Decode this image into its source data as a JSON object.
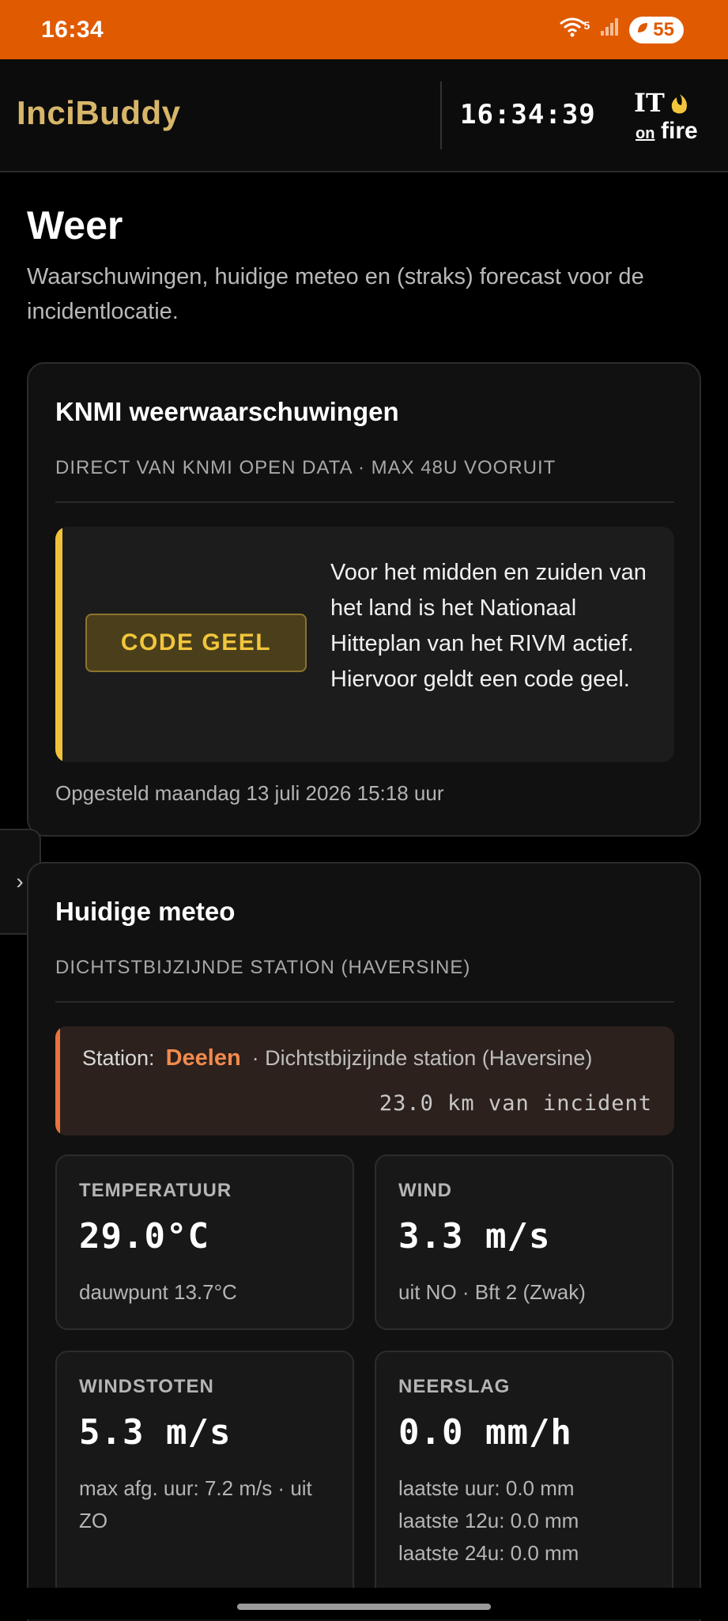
{
  "statusbar": {
    "time": "16:34",
    "network": "5",
    "battery": "55"
  },
  "app": {
    "brand": "InciBuddy",
    "clock": "16:34:39",
    "logo": {
      "top": "IT",
      "small": "on",
      "big": "fire"
    }
  },
  "page": {
    "title": "Weer",
    "subtitle": "Waarschuwingen, huidige meteo en (straks) forecast voor de incidentlocatie."
  },
  "knmi": {
    "title": "KNMI weerwaarschuwingen",
    "caption": "DIRECT VAN KNMI OPEN DATA · MAX 48U VOORUIT",
    "badge": "CODE GEEL",
    "text": "Voor het midden en zuiden van het land is het Nationaal Hitteplan van het RIVM actief. Hiervoor geldt een code geel.",
    "issued": "Opgesteld maandag 13 juli 2026 15:18 uur",
    "colors": {
      "accent": "#f0c23a",
      "badge_text": "#f2c53c"
    }
  },
  "drawer": {
    "toggle": "›"
  },
  "meteo": {
    "title": "Huidige meteo",
    "caption": "DICHTSTBIJZIJNDE STATION (HAVERSINE)",
    "station": {
      "label": "Station:",
      "name": "Deelen",
      "desc": "· Dichtstbijzijnde station (Haversine)",
      "distance": "23.0 km van incident"
    },
    "tiles": {
      "temperature": {
        "label": "TEMPERATUUR",
        "value": "29.0°C",
        "note": "dauwpunt 13.7°C"
      },
      "wind": {
        "label": "WIND",
        "value": "3.3 m/s",
        "note": "uit NO · Bft 2 (Zwak)"
      },
      "gusts": {
        "label": "WINDSTOTEN",
        "value": "5.3 m/s",
        "note": "max afg. uur: 7.2 m/s · uit ZO"
      },
      "precip": {
        "label": "NEERSLAG",
        "value": "0.0 mm/h",
        "note1": "laatste uur: 0.0 mm",
        "note2": "laatste 12u: 0.0 mm",
        "note3": "laatste 24u: 0.0 mm"
      }
    },
    "colors": {
      "station_accent": "#e8743c"
    }
  },
  "theme": {
    "brand": "#d7b66a",
    "statusbar": "#e05a00"
  }
}
